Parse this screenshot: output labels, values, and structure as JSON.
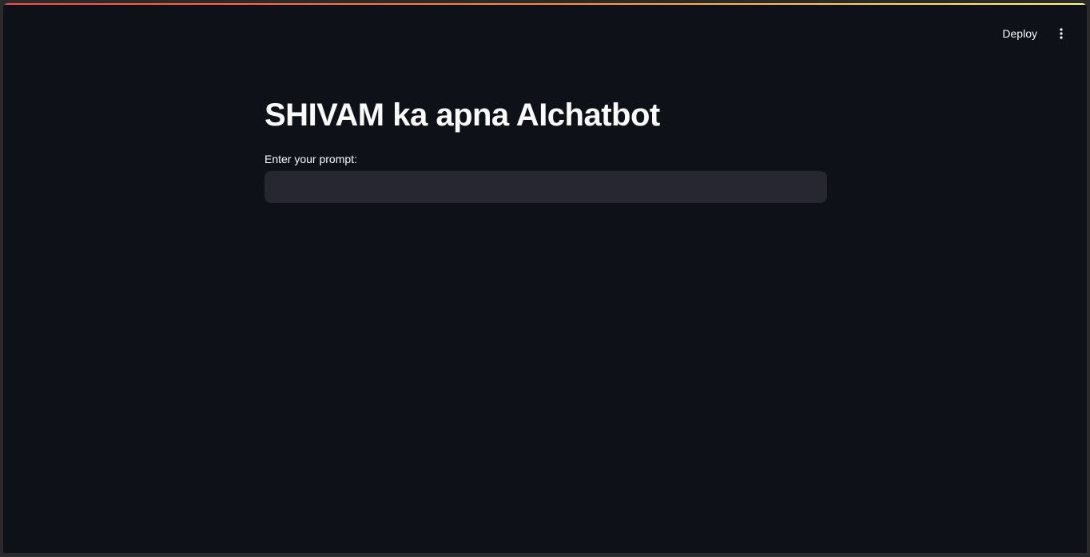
{
  "header": {
    "deploy_label": "Deploy",
    "menu_icon": "more-vertical-icon"
  },
  "main": {
    "title": "SHIVAM ka apna AIchatbot",
    "prompt_label": "Enter your prompt:",
    "prompt_value": "",
    "prompt_placeholder": ""
  },
  "colors": {
    "background": "#0e1117",
    "input_background": "#262730",
    "text": "#fafafa",
    "accent_gradient_start": "#ff4b4b",
    "accent_gradient_end": "#fffd80"
  }
}
